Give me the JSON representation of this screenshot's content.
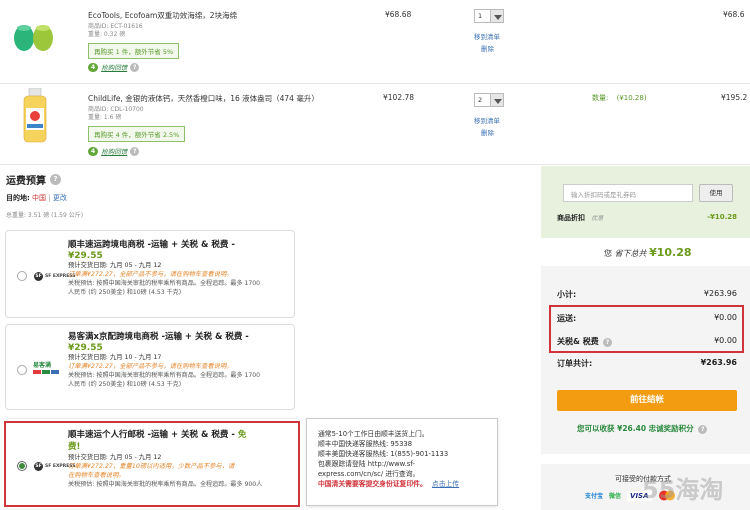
{
  "products": [
    {
      "name": "EcoTools, Ecofoam双重功效海绵，2块海绵",
      "id_text": "商品ID: ECT-01616",
      "weight_text": "重量: 0.32 磅",
      "promo": "再购买 1 件，额外节省 5%",
      "badge_num": "4",
      "badge_text": "抢购回馈",
      "price": "¥68.68",
      "qty": "1",
      "move_link": "移到清单",
      "delete_link": "删除",
      "line_total": "¥68.6"
    },
    {
      "name": "ChildLife, 金银的液体钙，天然香橙口味，16 液体盎司（474 毫升）",
      "id_text": "商品ID: CDL-10700",
      "weight_text": "重量: 1.6 磅",
      "promo": "再购买 4 件，额外节省 2.5%",
      "badge_num": "4",
      "badge_text": "抢购回馈",
      "price": "¥102.78",
      "qty": "2",
      "move_link": "移到清单",
      "delete_link": "删除",
      "discount_label": "数量:",
      "discount_value": "(¥10.28)",
      "line_total": "¥195.2"
    }
  ],
  "shipping": {
    "header": "运费预算",
    "dest_label": "目的地:",
    "dest_value": "中国",
    "change_link": "更改",
    "weight_line": "总重量: 3.51 磅 (1.59 公斤)",
    "options": [
      {
        "logo": "SF EXPRESS",
        "title": "顺丰速运跨境电商税 -运输 + 关税 & 税费 -",
        "price": "¥29.55",
        "eta": "预计交货日期: 九月 05 - 九月 12",
        "warn": "订单满¥272.27，全部产品不参与，请在购物车查看说明。",
        "note": "关税预估: 按照中国海关审批的税率乘所有商品。全程追踪。最多 1700",
        "note2": "人民币 (约 250美金) 和10磅 (4.53 千克)",
        "selected": false
      },
      {
        "logo": "易客满",
        "title": "易客满x京配跨境电商税 -运输 + 关税 & 税费 -",
        "price": "¥29.55",
        "eta": "预计交货日期: 九月 10 - 九月 17",
        "warn": "订单满¥272.27，全部产品不参与，请在购物车查看说明。",
        "note": "关税预估: 按照中国海关审批的税率乘所有商品。全程追踪。最多 1700",
        "note2": "人民币 (约 250美金) 和10磅 (4.53 千克)",
        "selected": false
      },
      {
        "logo": "SF EXPRESS",
        "title": "顺丰速运个人行邮税 -运输 + 关税 & 税费 -",
        "title_free": "免",
        "title_free2": "费!",
        "eta": "预计交货日期: 九月 05 - 九月 12",
        "warn": "订单满¥272.27，重量10磅以内适用，少数产品不参与，请",
        "warn2": "在购物车查看说明。",
        "note": "关税预估: 按照中国海关审批的税率乘所有商品。全程追踪。最多 900人",
        "selected": true
      }
    ],
    "tooltip": {
      "line1": "通常5-10个工作日由顺丰送货上门。",
      "line2": "顺丰中国快递客服热线: 95338",
      "line3": "顺丰美国快递客服热线: 1(855)-901-1133",
      "line4": "包裹跟踪请登陆 http://www.sf-",
      "line5": "express.com/cn/sc/ 进行查询。",
      "line6": "中国清关需要客提交身份证复印件。",
      "link": "点击上传"
    }
  },
  "summary": {
    "coupon_placeholder": "输入折扣码或是礼券码",
    "apply_button": "使用",
    "discount_label": "商品折扣",
    "discount_sub": "优惠",
    "discount_value": "-¥10.28",
    "saved_prefix": "您",
    "saved_word": "省下总共",
    "saved_value": "¥10.28",
    "subtotal_label": "小计:",
    "subtotal_value": "¥263.96",
    "shipping_label": "运送:",
    "shipping_value": "¥0.00",
    "tax_label": "关税& 税费",
    "tax_value": "¥0.00",
    "total_label": "订单共计:",
    "total_value": "¥263.96",
    "checkout_button": "前往结帐",
    "rewards": "您可以收获 ¥26.40 忠诚奖励积分",
    "payment_title": "可接受的付款方式",
    "pay_alipay": "支付宝",
    "pay_wechat": "微信",
    "pay_visa": "VISA"
  },
  "watermark": "55海淘",
  "colors": {
    "accent_green": "#64a73b",
    "checkout_orange": "#f39c12",
    "red_highlight": "#d0343a",
    "link_blue": "#3a6fb5"
  }
}
